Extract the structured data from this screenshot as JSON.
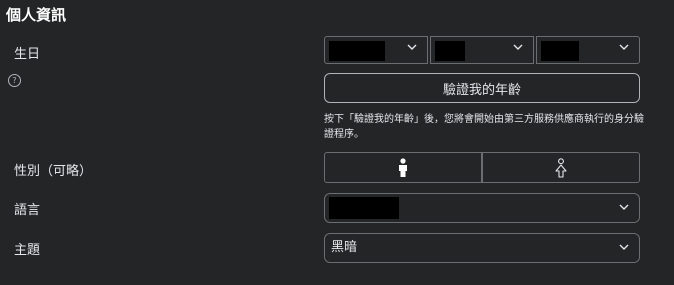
{
  "section": {
    "title": "個人資訊"
  },
  "birthday": {
    "label": "生日",
    "help_icon": "question-circle-icon",
    "year": {
      "value": "",
      "icon": "chevron-down-icon"
    },
    "month": {
      "value": "",
      "icon": "chevron-down-icon"
    },
    "day": {
      "value": "",
      "icon": "chevron-down-icon"
    },
    "verify_button": "驗證我的年齡",
    "note": "按下「驗證我的年齡」後，您將會開始由第三方服務供應商執行的身分驗證程序。"
  },
  "gender": {
    "label": "性別（可略）",
    "options": [
      {
        "icon": "person-filled-icon",
        "selected": true
      },
      {
        "icon": "person-outline-icon",
        "selected": false
      }
    ]
  },
  "language": {
    "label": "語言",
    "value": "",
    "icon": "chevron-down-icon"
  },
  "theme": {
    "label": "主題",
    "value": "黑暗",
    "icon": "chevron-down-icon"
  }
}
